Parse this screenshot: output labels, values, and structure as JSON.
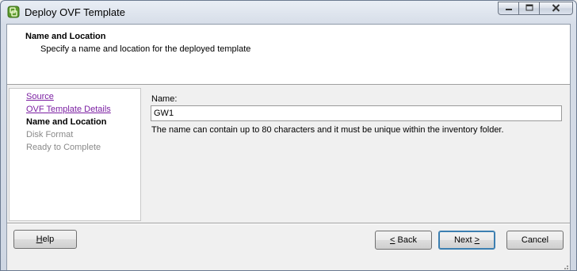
{
  "window": {
    "title": "Deploy OVF Template",
    "controls": {
      "minimize": "minimize-icon",
      "maximize": "maximize-icon",
      "close": "close-icon"
    }
  },
  "header": {
    "title": "Name and Location",
    "subtitle": "Specify a name and location for the deployed template"
  },
  "steps": [
    {
      "label": "Source",
      "state": "link"
    },
    {
      "label": "OVF Template Details",
      "state": "link"
    },
    {
      "label": "Name and Location",
      "state": "current"
    },
    {
      "label": "Disk Format",
      "state": "disabled"
    },
    {
      "label": "Ready to Complete",
      "state": "disabled"
    }
  ],
  "form": {
    "name_label": "Name:",
    "name_value": "GW1",
    "help_text": "The name can contain up to 80 characters and it must be unique within the inventory folder."
  },
  "buttons": {
    "help": {
      "mnemonic": "H",
      "rest": "elp"
    },
    "back": {
      "prefix": "",
      "mnemonic": "<",
      "rest": " Back"
    },
    "next": {
      "prefix": "Next ",
      "mnemonic": ">",
      "rest": ""
    },
    "cancel": "Cancel"
  },
  "colors": {
    "link": "#7b1fa2",
    "disabled": "#8a8a8a",
    "default_button_border": "#3c7fb1"
  }
}
